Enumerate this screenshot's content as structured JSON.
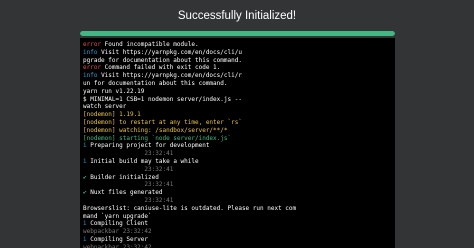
{
  "header": {
    "title": "Successfully Initialized!"
  },
  "progress": {
    "value": 1.0,
    "color": "#41b883"
  },
  "terminal": {
    "lines": [
      [
        {
          "t": "error",
          "c": "red"
        },
        {
          "t": " Found incompatible module."
        }
      ],
      [
        {
          "t": "info",
          "c": "blue"
        },
        {
          "t": " Visit https://yarnpkg.com/en/docs/cli/u"
        }
      ],
      [
        {
          "t": "pgrade for documentation about this command."
        }
      ],
      [
        {
          "t": "error",
          "c": "red"
        },
        {
          "t": " Command failed with exit code 1."
        }
      ],
      [
        {
          "t": "info",
          "c": "blue"
        },
        {
          "t": " Visit https://yarnpkg.com/en/docs/cli/r"
        }
      ],
      [
        {
          "t": "un for documentation about this command."
        }
      ],
      [
        {
          "t": "yarn run v1.22.19"
        }
      ],
      [
        {
          "t": "$ MINIMAL=1 CSB=1 nodemon server/index.js --"
        }
      ],
      [
        {
          "t": "watch server"
        }
      ],
      [
        {
          "t": "[nodemon] 1.19.1",
          "c": "yellow"
        }
      ],
      [
        {
          "t": "[nodemon] to restart at any time, enter `rs`",
          "c": "yellow"
        }
      ],
      [
        {
          "t": "[nodemon] watching: /sandbox/server/**/*",
          "c": "yellow"
        }
      ],
      [
        {
          "t": "[nodemon] starting `node server/index.js`",
          "c": "green"
        }
      ],
      [
        {
          "t": "i",
          "c": "blue"
        },
        {
          "t": " Preparing project for development"
        }
      ],
      [
        {
          "t": "                 23:32:41",
          "c": "gray"
        }
      ],
      [
        {
          "t": "i",
          "c": "blue"
        },
        {
          "t": " Initial build may take a while"
        }
      ],
      [
        {
          "t": "                 23:32:41",
          "c": "gray"
        }
      ],
      [
        {
          "t": "✔",
          "c": "green"
        },
        {
          "t": " Builder initialized"
        }
      ],
      [
        {
          "t": "                 23:32:41",
          "c": "gray"
        }
      ],
      [
        {
          "t": "✔",
          "c": "green"
        },
        {
          "t": " Nuxt files generated"
        }
      ],
      [
        {
          "t": "                 23:32:41",
          "c": "gray"
        }
      ],
      [
        {
          "t": "Browserslist: caniuse-lite is outdated. Please run next com"
        }
      ],
      [
        {
          "t": "mand `yarn upgrade`"
        }
      ],
      [
        {
          "t": "i",
          "c": "blue"
        },
        {
          "t": " Compiling Client"
        }
      ],
      [
        {
          "t": "webpackbar 23:32:42",
          "c": "gray"
        }
      ],
      [
        {
          "t": "i",
          "c": "blue"
        },
        {
          "t": " Compiling Server"
        }
      ],
      [
        {
          "t": "webpackbar 23:32:42",
          "c": "gray"
        }
      ]
    ]
  }
}
